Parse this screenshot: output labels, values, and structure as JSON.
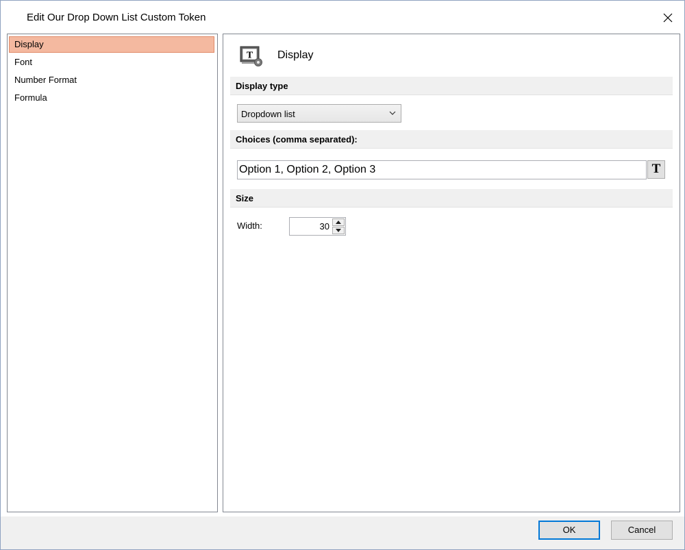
{
  "window": {
    "title": "Edit Our Drop Down List Custom Token"
  },
  "nav": {
    "items": [
      {
        "label": "Display",
        "selected": true
      },
      {
        "label": "Font",
        "selected": false
      },
      {
        "label": "Number Format",
        "selected": false
      },
      {
        "label": "Formula",
        "selected": false
      }
    ]
  },
  "main": {
    "header_title": "Display",
    "header_icon": "text-token-settings-icon",
    "sections": {
      "display_type": {
        "label": "Display type",
        "selected_value": "Dropdown list"
      },
      "choices": {
        "label": "Choices (comma separated):",
        "value": "Option 1, Option 2, Option 3",
        "text_button_label": "T"
      },
      "size": {
        "label": "Size",
        "width_label": "Width:",
        "width_value": "30"
      }
    }
  },
  "footer": {
    "ok_label": "OK",
    "cancel_label": "Cancel"
  },
  "colors": {
    "selection_background": "#f4b9a0",
    "selection_border": "#e08a68",
    "default_button_border": "#0078d7",
    "section_header_background": "#f0f0f0"
  }
}
